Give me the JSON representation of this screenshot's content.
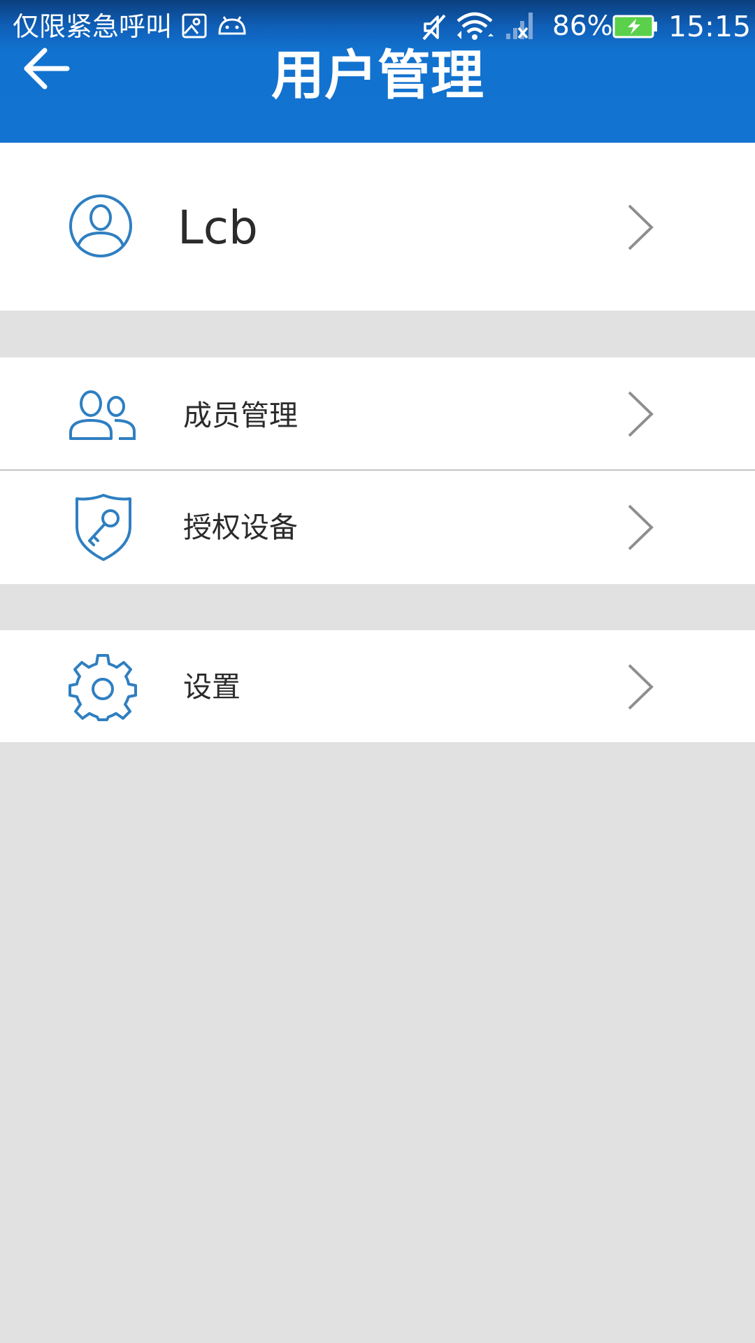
{
  "status_bar": {
    "carrier_text": "仅限紧急呼叫",
    "battery_percent": "86%",
    "time": "15:15",
    "icons": [
      "gallery-icon",
      "android-icon",
      "mute-icon",
      "wifi-icon",
      "no-signal-icon",
      "battery-charging-icon"
    ]
  },
  "app_bar": {
    "title": "用户管理",
    "back_icon": "arrow-left-icon"
  },
  "profile": {
    "username": "Lcb",
    "icon": "user-avatar-icon"
  },
  "menu": {
    "members": {
      "label": "成员管理",
      "icon": "members-icon"
    },
    "authorized_devices": {
      "label": "授权设备",
      "icon": "shield-key-icon"
    },
    "settings": {
      "label": "设置",
      "icon": "gear-icon"
    }
  },
  "colors": {
    "primary": "#1273d0",
    "status_bar_top": "#0b3f7e",
    "icon_blue": "#2f7fc1",
    "background": "#e1e1e1",
    "row_background": "#ffffff",
    "chevron": "#8e8e8e",
    "text": "#2b2b2b",
    "battery_green": "#5bd04a"
  }
}
